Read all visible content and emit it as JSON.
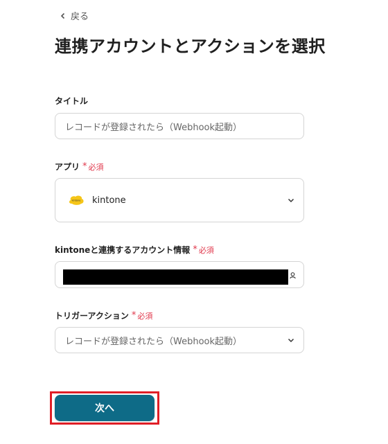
{
  "nav": {
    "back_label": "戻る"
  },
  "page": {
    "title": "連携アカウントとアクションを選択"
  },
  "required_label": "必須",
  "fields": {
    "title": {
      "label": "タイトル",
      "value": "レコードが登録されたら（Webhook起動）"
    },
    "app": {
      "label": "アプリ",
      "required": true,
      "selected": "kintone",
      "logo_text": "kintone",
      "icon": "chevron-down-icon"
    },
    "account": {
      "label": "kintoneと連携するアカウント情報",
      "required": true,
      "value_redacted": true,
      "icon": "account-icon"
    },
    "trigger_action": {
      "label": "トリガーアクション",
      "required": true,
      "selected": "レコードが登録されたら（Webhook起動）",
      "icon": "chevron-down-icon"
    }
  },
  "actions": {
    "next_label": "次へ"
  },
  "colors": {
    "primary": "#0e6b87",
    "required": "#e0364a",
    "highlight": "#e01e26",
    "kintone_yellow": "#f5c518"
  }
}
